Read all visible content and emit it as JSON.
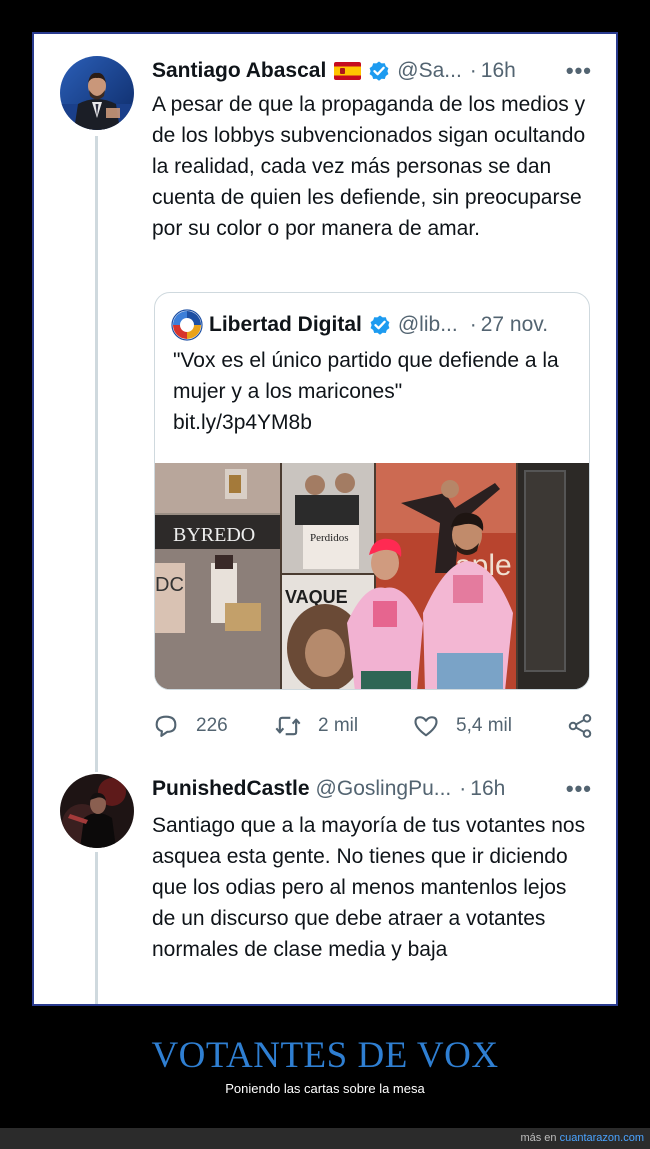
{
  "tweet1": {
    "name": "Santiago Abascal",
    "handle": "@Sa...",
    "dot": "·",
    "time": "16h",
    "more": "•••",
    "text": "A pesar de que la propaganda de los medios y de los lobbys subvencionados sigan ocultando la realidad, cada vez más personas se dan cuenta de quien les defiende, sin preocuparse por su color o por manera de amar.",
    "quote": {
      "name": "Libertad Digital",
      "handle": "@lib...",
      "dot": "·",
      "time": "27 nov.",
      "text_line1": "\"Vox es el único partido que defiende a la mujer y a los maricones\"",
      "link": "bit.ly/3p4YM8b",
      "photo_sign_1": "BYREDO",
      "photo_sign_2": "VAQUE",
      "photo_sign_3": "Perdidos",
      "photo_sign_4": "DC"
    },
    "actions": {
      "replies": "226",
      "retweets": "2 mil",
      "likes": "5,4 mil"
    }
  },
  "tweet2": {
    "name": "PunishedCastle",
    "handle": "@GoslingPu...",
    "dot": "·",
    "time": "16h",
    "more": "•••",
    "text": "Santiago que a la mayoría de tus votantes nos asquea esta gente. No tienes que ir diciendo que los odias pero al menos mantenlos lejos de un discurso que debe atraer a votantes normales de clase media y baja"
  },
  "caption": {
    "title": "VOTANTES DE VOX",
    "subtitle": "Poniendo las cartas sobre la mesa"
  },
  "footer": {
    "prefix": "más en ",
    "site": "cuantarazon.com"
  },
  "colors": {
    "frame_border": "#2a3b8f",
    "verified": "#1d9bf0",
    "caption_title": "#2f7fd2",
    "secondary_text": "#536471"
  }
}
